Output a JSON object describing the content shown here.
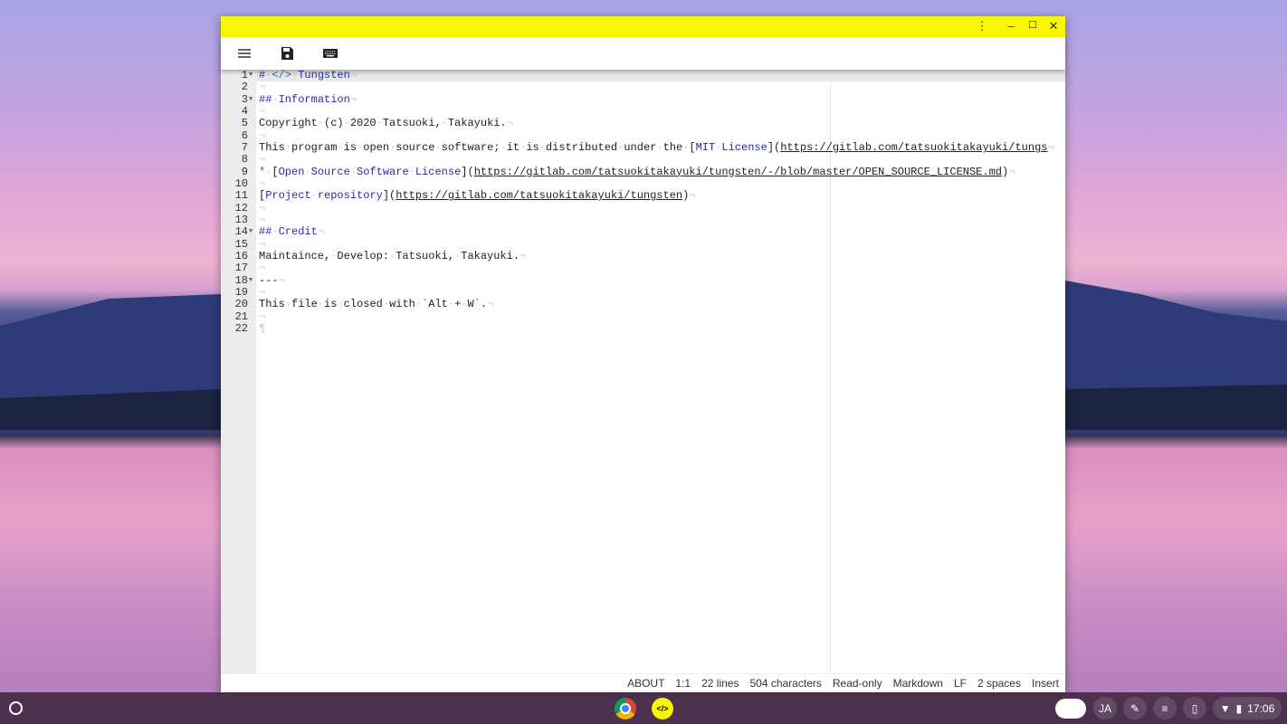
{
  "window": {
    "menu_icon": "menu-icon",
    "save_icon": "save-icon",
    "keyboard_icon": "keyboard-icon"
  },
  "lines": [
    {
      "n": "1",
      "fold": true,
      "segs": [
        [
          "head",
          "# "
        ],
        [
          "icon",
          "</>"
        ],
        [
          "head",
          " Tungsten"
        ]
      ]
    },
    {
      "n": "2",
      "segs": []
    },
    {
      "n": "3",
      "fold": true,
      "segs": [
        [
          "head",
          "## Information"
        ]
      ]
    },
    {
      "n": "4",
      "segs": []
    },
    {
      "n": "5",
      "segs": [
        [
          "plain",
          "Copyright (c) 2020 Tatsuoki, Takayuki."
        ]
      ]
    },
    {
      "n": "6",
      "segs": []
    },
    {
      "n": "7",
      "segs": [
        [
          "plain",
          "This program is open source software; it is distributed under the ["
        ],
        [
          "link",
          "MIT License"
        ],
        [
          "plain",
          "]("
        ],
        [
          "url",
          "https://gitlab.com/tatsuokitakayuki/tungs"
        ]
      ]
    },
    {
      "n": "8",
      "segs": []
    },
    {
      "n": "9",
      "segs": [
        [
          "bullet",
          "*"
        ],
        [
          "plain",
          " ["
        ],
        [
          "link",
          "Open Source Software License"
        ],
        [
          "plain",
          "]("
        ],
        [
          "url",
          "https://gitlab.com/tatsuokitakayuki/tungsten/-/blob/master/OPEN_SOURCE_LICENSE.md"
        ],
        [
          "plain",
          ")"
        ]
      ]
    },
    {
      "n": "10",
      "segs": []
    },
    {
      "n": "11",
      "segs": [
        [
          "plain",
          "["
        ],
        [
          "link",
          "Project repository"
        ],
        [
          "plain",
          "]("
        ],
        [
          "url",
          "https://gitlab.com/tatsuokitakayuki/tungsten"
        ],
        [
          "plain",
          ")"
        ]
      ]
    },
    {
      "n": "12",
      "segs": []
    },
    {
      "n": "13",
      "segs": []
    },
    {
      "n": "14",
      "fold": true,
      "segs": [
        [
          "head",
          "## Credit"
        ]
      ]
    },
    {
      "n": "15",
      "segs": []
    },
    {
      "n": "16",
      "segs": [
        [
          "plain",
          "Maintaince, Develop: Tatsuoki, Takayuki."
        ]
      ]
    },
    {
      "n": "17",
      "segs": []
    },
    {
      "n": "18",
      "fold": true,
      "segs": [
        [
          "plain",
          "---"
        ]
      ]
    },
    {
      "n": "19",
      "segs": []
    },
    {
      "n": "20",
      "segs": [
        [
          "plain",
          "This file is closed with `Alt + W`."
        ]
      ]
    },
    {
      "n": "21",
      "segs": []
    },
    {
      "n": "22",
      "last": true,
      "segs": []
    }
  ],
  "status": {
    "about": "ABOUT",
    "cursor": "1:1",
    "lines": "22 lines",
    "chars": "504 characters",
    "mode": "Read-only",
    "lang": "Markdown",
    "eol": "LF",
    "indent": "2 spaces",
    "insert": "Insert"
  },
  "shelf": {
    "ime": "JA",
    "time": "17:06"
  },
  "colors": {
    "titlebar": "#f7f700"
  }
}
